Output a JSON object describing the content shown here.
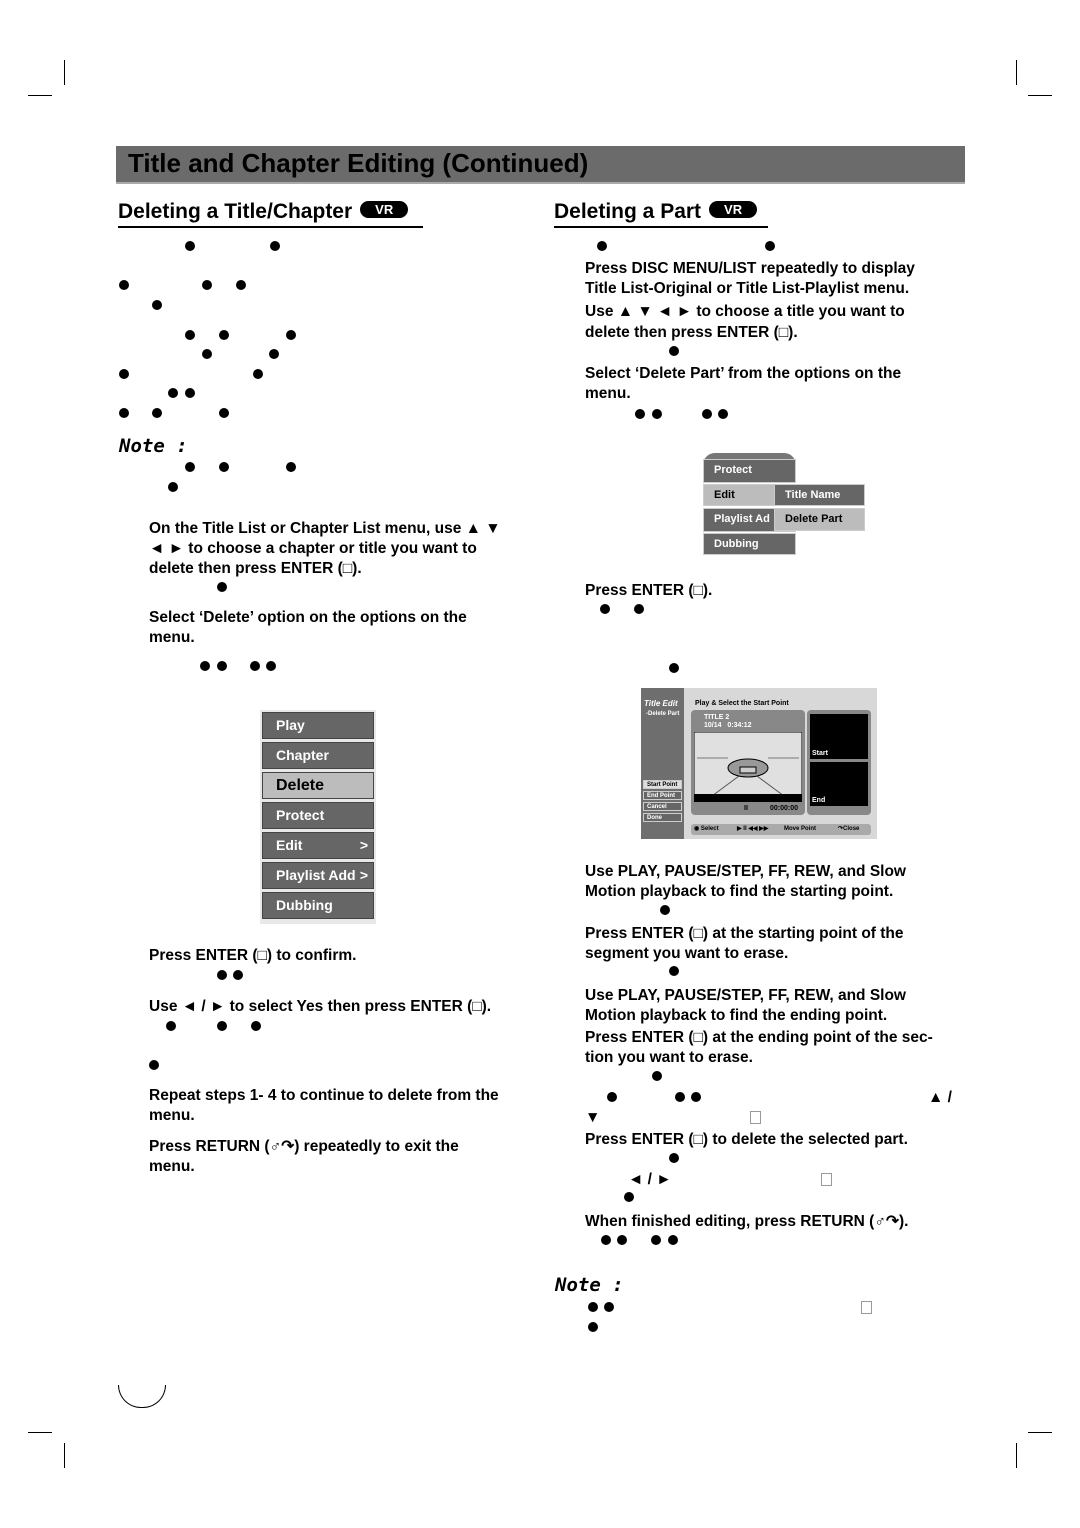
{
  "header": {
    "title": "Title and Chapter Editing (Continued)"
  },
  "left": {
    "heading": "Deleting a Title/Chapter",
    "badge": "VR",
    "note_label": "Note :",
    "lines": [
      "On the Title List or Chapter List menu, use ▲ ▼",
      "◄ ► to choose a chapter or title you want to",
      "delete then press ENTER (□).",
      "Select ‘Delete’ option on the options on the",
      "menu.",
      "Press ENTER (□) to confirm.",
      "Use ◄ / ► to select  Yes  then press ENTER (□).",
      "Repeat steps 1- 4 to continue to delete from the",
      "menu.",
      "Press RETURN (♂↷) repeatedly to exit the",
      "menu."
    ],
    "menu": [
      {
        "label": "Play"
      },
      {
        "label": "Chapter"
      },
      {
        "label": "Delete",
        "selected": true
      },
      {
        "label": "Protect"
      },
      {
        "label": "Edit",
        "chevron": ">"
      },
      {
        "label": "Playlist Add",
        "chevron": ">"
      },
      {
        "label": "Dubbing"
      }
    ]
  },
  "right": {
    "heading": "Deleting a Part",
    "badge": "VR",
    "note_label": "Note :",
    "lines": [
      "Press DISC MENU/LIST repeatedly to display",
      "Title List-Original or Title List-Playlist menu.",
      "Use ▲ ▼ ◄ ► to choose a title you want to",
      "delete then press ENTER (□).",
      "Select ‘Delete Part’ from the options on the",
      "menu.",
      "Press ENTER (□).",
      "Use PLAY, PAUSE/STEP, FF, REW, and Slow",
      "Motion playback to find the starting point.",
      "Press ENTER (□) at the starting point of the",
      "segment you want to erase.",
      "Use PLAY, PAUSE/STEP, FF, REW, and Slow",
      "Motion playback to find the ending point.",
      "Press ENTER (□) at the ending point of the sec-",
      "tion you want to erase.",
      "▲ /",
      "▼",
      "Press ENTER (□) to delete the selected part.",
      "◄ / ►",
      "When finished editing, press RETURN (♂↷)."
    ],
    "menu": {
      "items": [
        "Protect",
        "Edit",
        "Playlist Ad",
        "Dubbing"
      ],
      "submenu": [
        "Title Name",
        "Delete Part"
      ]
    },
    "screen": {
      "title": "Title Edit",
      "subtitle": "-Delete Part",
      "header": "Play & Select the Start Point",
      "clip_title": "TITLE 2",
      "clip_date": "10/14",
      "clip_time": "0:34:12",
      "timecode": "00:00:00",
      "pause": "II",
      "start_label": "Start",
      "end_label": "End",
      "buttons": [
        "Start Point",
        "End Point",
        "Cancel",
        "Done"
      ],
      "footer": {
        "select": "Select",
        "transport": "▶ II ◀◀ ▶▶",
        "move": "Move Point",
        "close": "Close"
      }
    }
  }
}
